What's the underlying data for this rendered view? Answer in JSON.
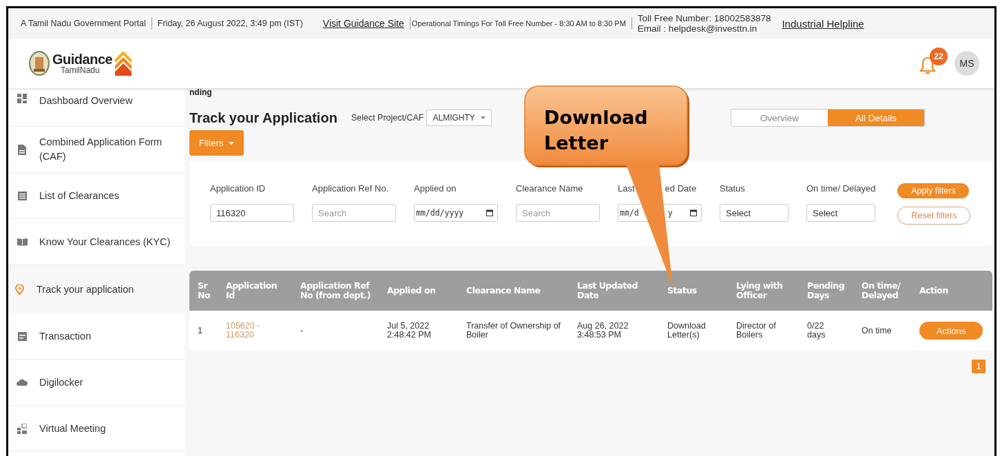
{
  "top_bar": {
    "portal": "A Tamil Nadu Government Portal",
    "datetime": "Friday, 26 August 2022, 3:49 pm (IST)",
    "visit_link": "Visit Guidance Site",
    "timings": "Operational Timings For Toll Free Number - 8:30 AM to 8:30 PM",
    "toll_free": "Toll Free Number: 18002583878",
    "email": "Email : helpdesk@investtn.in",
    "helpline": "Industrial Helpline"
  },
  "header": {
    "logo_title": "Guidance",
    "logo_subtitle": "TamilNadu",
    "notifications": "22",
    "avatar": "MS"
  },
  "sidebar": {
    "items": [
      {
        "label": "Dashboard Overview",
        "selected": false
      },
      {
        "label": "Combined Application Form (CAF)",
        "selected": false
      },
      {
        "label": "List of Clearances",
        "selected": false
      },
      {
        "label": "Know Your Clearances (KYC)",
        "selected": false
      },
      {
        "label": "Track your application",
        "selected": true
      },
      {
        "label": "Transaction",
        "selected": false
      },
      {
        "label": "Digilocker",
        "selected": false
      },
      {
        "label": "Virtual Meeting",
        "selected": false
      }
    ]
  },
  "breadcrumb": "nding",
  "page_title": "Track your Application",
  "project_select": {
    "label": "Select Project/CAF",
    "value": "ALMIGHTY"
  },
  "view_tabs": [
    {
      "label": "Overview",
      "selected": false
    },
    {
      "label": "All Details",
      "selected": true
    }
  ],
  "filters_button": "Filters",
  "filters": {
    "fields": [
      {
        "label": "Application ID",
        "kind": "text",
        "value": "116320"
      },
      {
        "label": "Application Ref No.",
        "kind": "text",
        "placeholder": "Search"
      },
      {
        "label": "Applied on",
        "kind": "date",
        "value": "mm/dd/yyyy"
      },
      {
        "label": "Clearance Name",
        "kind": "text",
        "placeholder": "Search"
      },
      {
        "label_parts": [
          "Last",
          "ed Date"
        ],
        "kind": "date",
        "value_parts": [
          "mm/d",
          "y"
        ]
      },
      {
        "label": "Status",
        "kind": "select",
        "value": "Select"
      },
      {
        "label": "On time/ Delayed",
        "kind": "select",
        "value": "Select"
      }
    ],
    "apply": "Apply filters",
    "reset": "Reset filters"
  },
  "table": {
    "columns": [
      "Sr No",
      "Application Id",
      "Application Ref No (from dept.)",
      "Applied on",
      "Clearance Name",
      "Last Updated Date",
      "Status",
      "Lying with Officer",
      "Pending Days",
      "On time/ Delayed",
      "Action"
    ],
    "rows": [
      {
        "cells": [
          "1",
          "105620 - 116320",
          "-",
          "Jul 5, 2022 2:48:42 PM",
          "Transfer of Ownership of Boiler",
          "Aug 26, 2022 3:48:53 PM",
          "Download Letter(s)",
          "Director of Boilers",
          "0/22 days",
          "On time"
        ],
        "action": "Actions"
      }
    ]
  },
  "pagination": [
    {
      "label": "1",
      "selected": true
    }
  ],
  "callout": {
    "text": "Download Letter"
  }
}
